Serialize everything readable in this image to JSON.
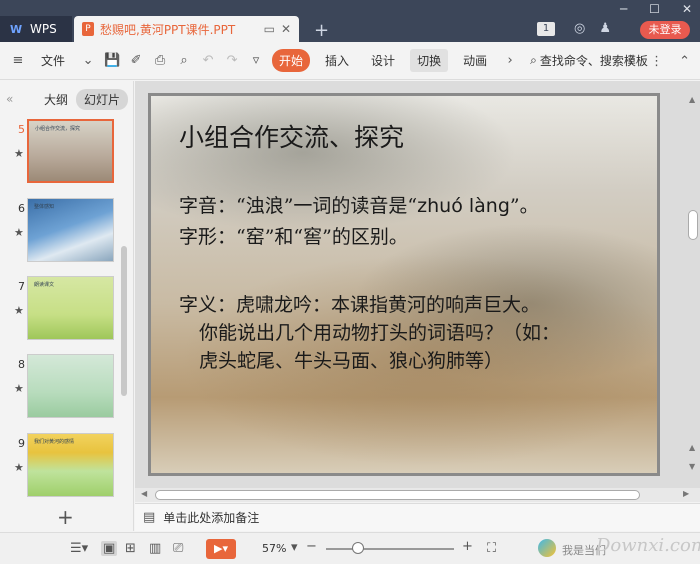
{
  "titlebar": {
    "app_tab": "WPS",
    "doc_tab": "愁赐吧,黄河PPT课件.PPT",
    "badge": "1",
    "login": "未登录"
  },
  "menubar": {
    "file": "文件",
    "items": [
      {
        "label": "开始",
        "state": "active"
      },
      {
        "label": "插入",
        "state": ""
      },
      {
        "label": "设计",
        "state": ""
      },
      {
        "label": "切换",
        "state": "boxed"
      },
      {
        "label": "动画",
        "state": ""
      }
    ],
    "search_cmd": "查找命令、搜索模板"
  },
  "leftpane": {
    "tab_outline": "大纲",
    "tab_slides": "幻灯片",
    "thumbs": [
      {
        "num": "5",
        "title": "小组合作交流，探究",
        "selected": true
      },
      {
        "num": "6",
        "title": "整体感知",
        "selected": false
      },
      {
        "num": "7",
        "title": "朗读课文",
        "selected": false
      },
      {
        "num": "8",
        "title": "",
        "selected": false
      },
      {
        "num": "9",
        "title": "我们对黄河的感情",
        "selected": false
      }
    ]
  },
  "slide": {
    "title": "小组合作交流、探究",
    "line1a": "字音：“浊浪”一词的读音是“",
    "line1_pinyin": "zhuó làng",
    "line1b": "”。",
    "line2": "字形：“窑”和“窖”的区别。",
    "line3": "字义：虎啸龙吟：本课指黄河的响声巨大。",
    "line4": "你能说出几个用动物打头的词语吗？（如：",
    "line5": "虎头蛇尾、牛头马面、狼心狗肺等）"
  },
  "notes": {
    "placeholder": "单击此处添加备注"
  },
  "statusbar": {
    "zoom": "57%",
    "watermark_small": "我是当们",
    "watermark_logo": "Downxi.com"
  }
}
